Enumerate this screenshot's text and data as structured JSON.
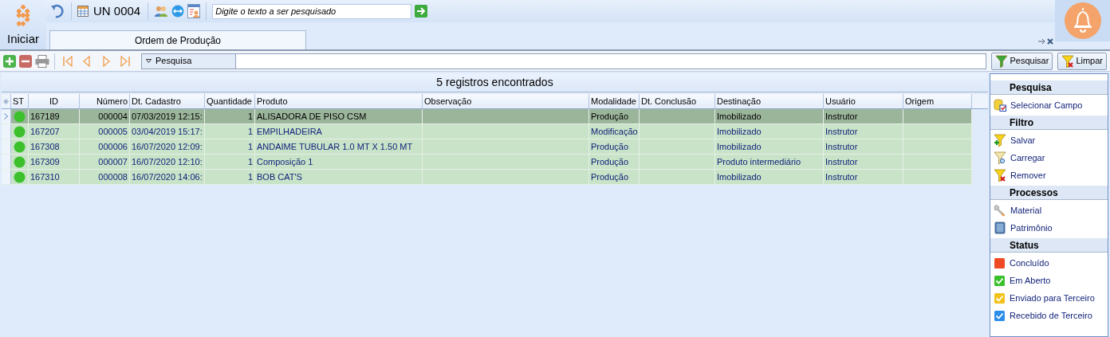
{
  "top_bar": {
    "start_label": "Iniciar",
    "unit": "UN 0004",
    "search": {
      "placeholder": "Digite o texto a ser pesquisado"
    }
  },
  "tabs": [
    {
      "label": "Ordem de Produção",
      "selected": true
    }
  ],
  "toolbar": {
    "search_dropdown": "Pesquisa",
    "buttons": [
      "Pesquisar",
      "Limpar"
    ]
  },
  "grid": {
    "summary": "5 registros encontrados",
    "columns": [
      "ST",
      "ID",
      "Número",
      "Dt. Cadastro",
      "Quantidade",
      "Produto",
      "Observação",
      "Modalidade",
      "Dt. Conclusão",
      "Destinação",
      "Usuário",
      "Origem"
    ],
    "rows": [
      {
        "selected": true,
        "color": "#3cc02c",
        "id": "167189",
        "numero": "000004",
        "dt_cadastro": "07/03/2019 12:15:",
        "quantidade": "1",
        "produto": "ALISADORA DE PISO CSM",
        "modalidade": "Produção",
        "destinacao": "Imobilizado",
        "usuario": "Instrutor"
      },
      {
        "selected": false,
        "color": "#3cc02c",
        "id": "167207",
        "numero": "000005",
        "dt_cadastro": "03/04/2019 15:17:",
        "quantidade": "1",
        "produto": "EMPILHADEIRA",
        "modalidade": "Modificação",
        "destinacao": "Imobilizado",
        "usuario": "Instrutor"
      },
      {
        "selected": false,
        "color": "#3cc02c",
        "id": "167308",
        "numero": "000006",
        "dt_cadastro": "16/07/2020 12:09:",
        "quantidade": "1",
        "produto": "ANDAIME TUBULAR 1.0 MT X 1.50 MT",
        "modalidade": "Produção",
        "destinacao": "Imobilizado",
        "usuario": "Instrutor"
      },
      {
        "selected": false,
        "color": "#3cc02c",
        "id": "167309",
        "numero": "000007",
        "dt_cadastro": "16/07/2020 12:10:",
        "quantidade": "1",
        "produto": "Composição 1",
        "modalidade": "Produção",
        "destinacao": "Produto intermediário",
        "usuario": "Instrutor"
      },
      {
        "selected": false,
        "color": "#3cc02c",
        "id": "167310",
        "numero": "000008",
        "dt_cadastro": "16/07/2020 14:06:",
        "quantidade": "1",
        "produto": "BOB CAT'S",
        "modalidade": "Produção",
        "destinacao": "Imobilizado",
        "usuario": "Instrutor"
      }
    ]
  },
  "side_panel": {
    "sections": [
      {
        "title": "Pesquisa",
        "items": [
          {
            "label": "Selecionar Campo"
          }
        ]
      },
      {
        "title": "Filtro",
        "items": [
          {
            "label": "Salvar"
          },
          {
            "label": "Carregar"
          },
          {
            "label": "Remover"
          }
        ]
      },
      {
        "title": "Processos",
        "items": [
          {
            "label": "Material"
          },
          {
            "label": "Patrimônio"
          }
        ]
      },
      {
        "title": "Status",
        "items": [
          {
            "label": "Concluído",
            "color": "#f04a24",
            "checked": false
          },
          {
            "label": "Em Aberto",
            "color": "#3cc02c",
            "checked": true
          },
          {
            "label": "Enviado para Terceiro",
            "color": "#f2c21a",
            "checked": true
          },
          {
            "label": "Recebido de Terceiro",
            "color": "#2c8ee8",
            "checked": true
          }
        ]
      }
    ]
  }
}
